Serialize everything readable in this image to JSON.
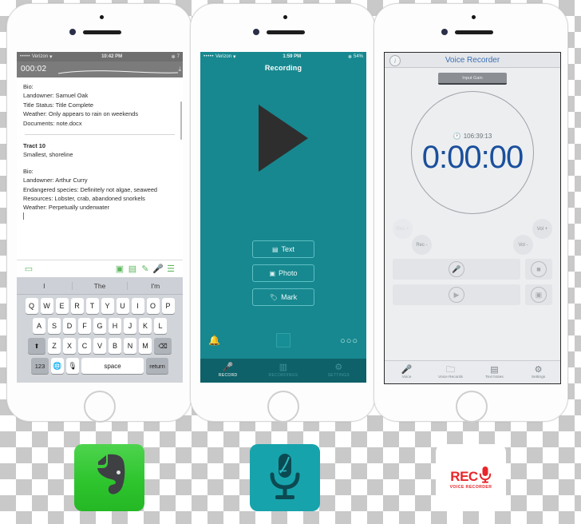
{
  "phone1": {
    "name": "evernote-phone",
    "status": {
      "carrier": "Verizon",
      "dots": "•••••",
      "wifi": "▾",
      "time": "10:42 PM",
      "bluetooth": "✻",
      "battery": "7"
    },
    "player": {
      "elapsed": "000:02",
      "download_icon": "⤓"
    },
    "note": {
      "lines_top": [
        "Bio:",
        "Landowner: Samuel Oak",
        "Title Status: Title Complete",
        "Weather: Only appears to rain on weekends",
        "Documents: note.docx"
      ],
      "heading": "Tract 10",
      "subheading": "Smallest, shoreline",
      "lines_bottom": [
        "Bio:",
        "Landowner: Arthur Curry",
        "Endangered species: Definitely not algae, seaweed",
        "Resources: Lobster, crab, abandoned snorkels",
        "Weather: Perpetually underwater"
      ]
    },
    "toolbar": [
      {
        "name": "chat-icon",
        "glyph": "▭"
      },
      {
        "name": "camera-icon",
        "glyph": "▣"
      },
      {
        "name": "attachment-icon",
        "glyph": "▤"
      },
      {
        "name": "pen-icon",
        "glyph": "✎"
      },
      {
        "name": "microphone-icon",
        "glyph": "🎤"
      },
      {
        "name": "checklist-icon",
        "glyph": "☰"
      }
    ],
    "keyboard": {
      "predictions": [
        "I",
        "The",
        "I'm"
      ],
      "row1": [
        "Q",
        "W",
        "E",
        "R",
        "T",
        "Y",
        "U",
        "I",
        "O",
        "P"
      ],
      "row2": [
        "A",
        "S",
        "D",
        "F",
        "G",
        "H",
        "J",
        "K",
        "L"
      ],
      "row3_shift": "⬆",
      "row3": [
        "Z",
        "X",
        "C",
        "V",
        "B",
        "N",
        "M"
      ],
      "row3_backspace": "⌫",
      "numbers_key": "123",
      "globe_key": "🌐",
      "mic_key": "🎙",
      "space_key": "space",
      "return_key": "return"
    }
  },
  "phone2": {
    "name": "teal-recorder-phone",
    "status": {
      "carrier": "Verizon",
      "dots": "•••••",
      "wifi": "▾",
      "time": "1:59 PM",
      "bluetooth": "✻",
      "battery": "54%"
    },
    "nav_title": "Recording",
    "play_button": "play-triangle",
    "actions": [
      {
        "label": "Text",
        "icon": "text-icon",
        "glyph": "▤"
      },
      {
        "label": "Photo",
        "icon": "photo-icon",
        "glyph": "▣"
      },
      {
        "label": "Mark",
        "icon": "mark-icon",
        "glyph": "🏷"
      }
    ],
    "lower": {
      "bell": "🔔",
      "stop": "stop-square",
      "dots": "○○○"
    },
    "tabs": [
      {
        "label": "RECORD",
        "icon": "microphone-icon",
        "glyph": "🎤",
        "active": true
      },
      {
        "label": "RECORDINGS",
        "icon": "bars-icon",
        "glyph": "▥",
        "active": false
      },
      {
        "label": "SETTINGS",
        "icon": "gear-icon",
        "glyph": "⚙",
        "active": false
      }
    ]
  },
  "phone3": {
    "name": "voice-recorder-phone",
    "nav_title": "Voice Recorder",
    "info_icon": "i",
    "input_gain_label": "Input Gain",
    "remaining_time": "106:39:13",
    "remaining_icon": "🕐",
    "timer": "0:00:00",
    "knobs": [
      {
        "label": "Rec +",
        "faint": true
      },
      {
        "label": "Rec -",
        "faint": false
      },
      {
        "label": "Vol +",
        "faint": false
      },
      {
        "label": "Vol -",
        "faint": false
      }
    ],
    "controls": [
      {
        "name": "record-button",
        "glyph": "🎤"
      },
      {
        "name": "stop-button",
        "glyph": "■"
      },
      {
        "name": "play-button",
        "glyph": "▶"
      },
      {
        "name": "save-button",
        "glyph": "▣"
      }
    ],
    "tabs": [
      {
        "label": "Voice",
        "icon": "microphone-icon",
        "glyph": "🎤"
      },
      {
        "label": "Voice Records",
        "icon": "folder-icon",
        "glyph": "🗀"
      },
      {
        "label": "Text Notes",
        "icon": "notes-icon",
        "glyph": "▤"
      },
      {
        "label": "Settings",
        "icon": "gear-icon",
        "glyph": "⚙"
      }
    ]
  },
  "app_icons": [
    {
      "name": "evernote-app-icon",
      "label": "",
      "color": "#2ec52e"
    },
    {
      "name": "teal-recorder-app-icon",
      "label": "",
      "color": "#17a3ac"
    },
    {
      "name": "rec-voice-recorder-app-icon",
      "label": "REC",
      "sublabel": "VOICE RECORDER",
      "color": "#e8262a"
    }
  ]
}
